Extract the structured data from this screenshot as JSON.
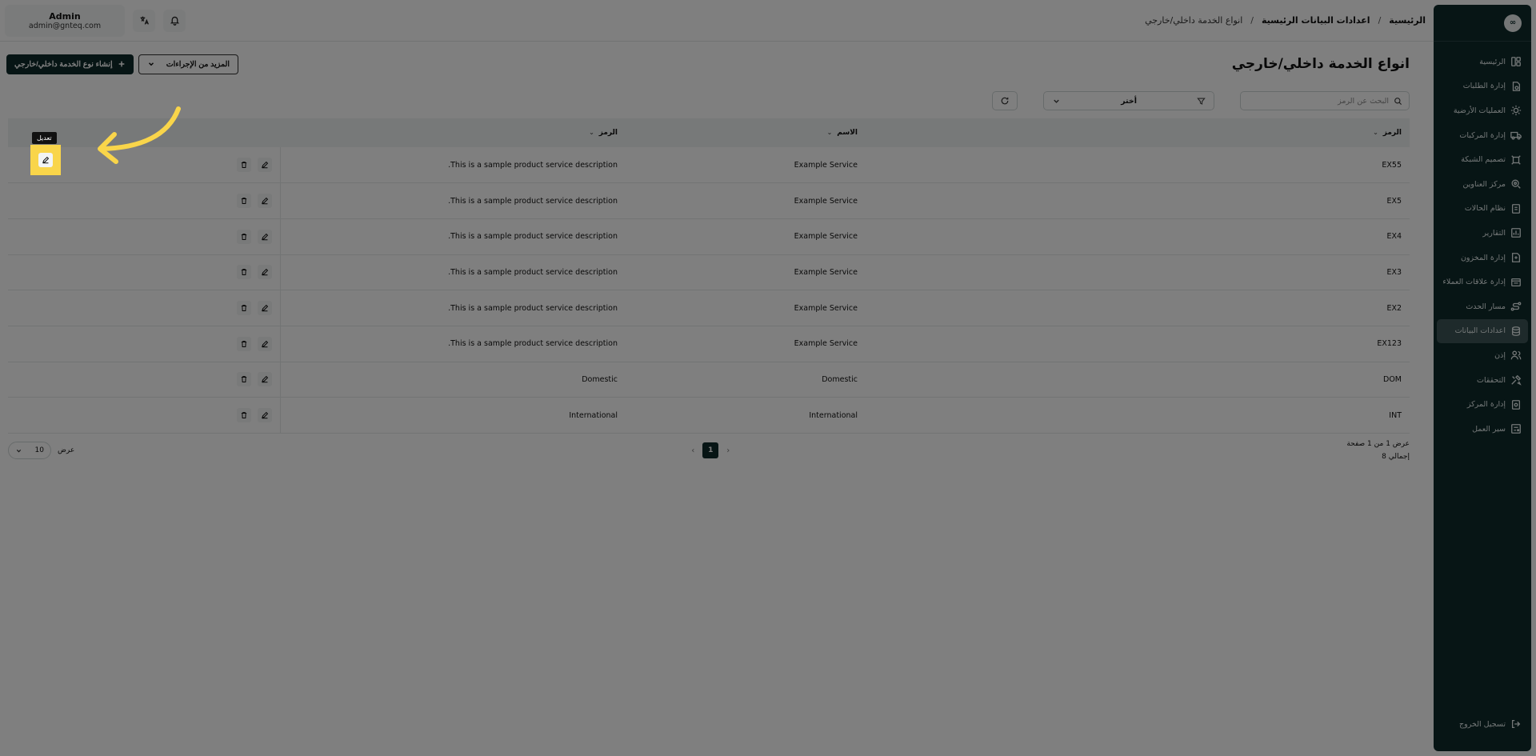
{
  "sidebar": {
    "logo": "∞",
    "items": [
      {
        "label": "الرئيسية",
        "icon": "layout-icon",
        "active": false
      },
      {
        "label": "إدارة الطلبات",
        "icon": "orders-icon",
        "active": false
      },
      {
        "label": "العمليات الأرضية",
        "icon": "sun-icon",
        "active": false
      },
      {
        "label": "إدارة المركبات",
        "icon": "truck-icon",
        "active": false
      },
      {
        "label": "تصميم الشبكة",
        "icon": "network-icon",
        "active": false
      },
      {
        "label": "مركز العناوين",
        "icon": "map-pin-icon",
        "active": false
      },
      {
        "label": "نظام الحالات",
        "icon": "status-icon",
        "active": false
      },
      {
        "label": "التقارير",
        "icon": "chart-icon",
        "active": false
      },
      {
        "label": "إدارة المخزون",
        "icon": "inventory-icon",
        "active": false
      },
      {
        "label": "إدارة علاقات العملاء",
        "icon": "crm-icon",
        "active": false
      },
      {
        "label": "مسار الحدث",
        "icon": "route-icon",
        "active": false
      },
      {
        "label": "اعدادات البيانات",
        "icon": "database-icon",
        "active": true
      },
      {
        "label": "إذن",
        "icon": "users-icon",
        "active": false
      },
      {
        "label": "التحققات",
        "icon": "tools-icon",
        "active": false
      },
      {
        "label": "إدارة المركز",
        "icon": "center-icon",
        "active": false
      },
      {
        "label": "سير العمل",
        "icon": "workflow-icon",
        "active": false
      }
    ],
    "logout": "تسجيل الخروج"
  },
  "breadcrumb": {
    "home": "الرئيسية",
    "parent": "اعدادات البيانات الرئيسية",
    "current": "انواع الخدمة داخلي/خارجي"
  },
  "user": {
    "name": "Admin",
    "email": "admin@gnteq.com"
  },
  "page": {
    "title": "انواع الخدمة داخلي/خارجي",
    "create_button": "إنشاء نوع الخدمة داخلي/خارجي",
    "more_actions": "المزيد من الإجراءات"
  },
  "filters": {
    "search_placeholder": "البحث عن الرمز",
    "select_label": "أختر"
  },
  "table": {
    "headers": {
      "code": "الرمز",
      "name": "الاسم",
      "description": "الرمز"
    },
    "rows": [
      {
        "code": "EX55",
        "name": "Example Service",
        "description": "This is a sample product service description."
      },
      {
        "code": "EX5",
        "name": "Example Service",
        "description": "This is a sample product service description."
      },
      {
        "code": "EX4",
        "name": "Example Service",
        "description": "This is a sample product service description."
      },
      {
        "code": "EX3",
        "name": "Example Service",
        "description": "This is a sample product service description."
      },
      {
        "code": "EX2",
        "name": "Example Service",
        "description": "This is a sample product service description."
      },
      {
        "code": "EX123",
        "name": "Example Service",
        "description": "This is a sample product service description."
      },
      {
        "code": "DOM",
        "name": "Domestic",
        "description": "Domestic"
      },
      {
        "code": "INT",
        "name": "International",
        "description": "International"
      }
    ]
  },
  "pagination": {
    "range_text": "عرض 1 من 1 صفحة",
    "total_text": "إجمالي 8",
    "current_page": "1",
    "per_page_label": "عرض",
    "per_page_value": "10"
  },
  "tooltip": {
    "edit": "تعديل"
  },
  "colors": {
    "sidebar_bg": "#0f2a2b",
    "accent": "#0f2a2b",
    "highlight": "#f9d54a"
  }
}
